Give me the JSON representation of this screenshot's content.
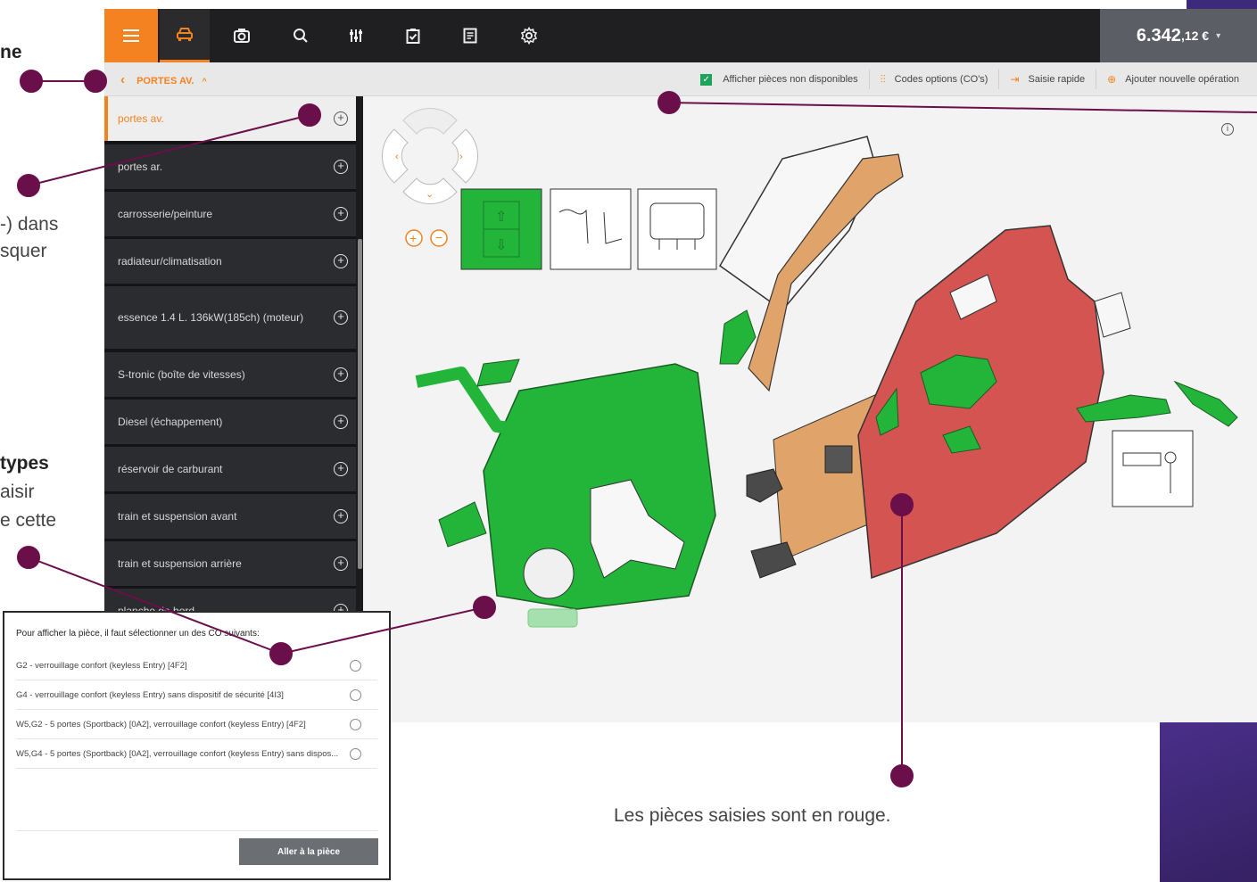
{
  "annotations": {
    "left_title_fragment": "ne",
    "left_text_fragment_1": "-) dans",
    "left_text_fragment_2": "squer",
    "left_bold_fragment": "types",
    "left_text_fragment_3": "aisir",
    "left_text_fragment_4": "e cette",
    "caption": "Les pièces saisies sont en rouge."
  },
  "topbar": {
    "menu_icon": "hamburger-icon",
    "icons": [
      "car-icon",
      "camera-icon",
      "search-icon",
      "sliders-icon",
      "clipboard-check-icon",
      "receipt-icon",
      "gear-icon"
    ],
    "price_main": "6.342",
    "price_decimals": ",12 €",
    "price_caret": "▾"
  },
  "subbar": {
    "breadcrumb": "PORTES AV.",
    "breadcrumb_back": "‹",
    "breadcrumb_caret": "^",
    "show_unavailable_label": "Afficher pièces non disponibles",
    "show_unavailable_checked": true,
    "option_codes_label": "Codes options (CO's)",
    "quick_entry_label": "Saisie rapide",
    "add_operation_label": "Ajouter nouvelle opération"
  },
  "sidebar": {
    "items": [
      {
        "label": "portes av.",
        "active": true
      },
      {
        "label": "portes ar."
      },
      {
        "label": "carrosserie/peinture"
      },
      {
        "label": "radiateur/climatisation"
      },
      {
        "label": "essence 1.4 L. 136kW(185ch) (moteur)"
      },
      {
        "label": "S-tronic (boîte de vitesses)"
      },
      {
        "label": "Diesel (échappement)"
      },
      {
        "label": "réservoir de carburant"
      },
      {
        "label": "train et suspension avant"
      },
      {
        "label": "train et suspension arrière"
      },
      {
        "label": "planche de bord"
      }
    ]
  },
  "popup": {
    "heading": "Pour afficher la pièce, il faut sélectionner un des CO suivants:",
    "options": [
      "G2 - verrouillage confort (keyless Entry) [4F2]",
      "G4 - verrouillage confort (keyless Entry) sans dispositif de sécurité [4I3]",
      "W5,G2 - 5 portes (Sportback) [0A2], verrouillage confort (keyless Entry) [4F2]",
      "W5,G4 - 5 portes (Sportback) [0A2], verrouillage confort (keyless Entry) sans dispos..."
    ],
    "button_label": "Aller à la pièce"
  },
  "colors": {
    "accent_orange": "#f58220",
    "topbar_dark": "#1f1f21",
    "part_green": "#22b53a",
    "part_red": "#d35450",
    "part_tan": "#e0a46a",
    "annotation_purple": "#6b0f4a",
    "brand_purple": "#3d2a7a"
  }
}
